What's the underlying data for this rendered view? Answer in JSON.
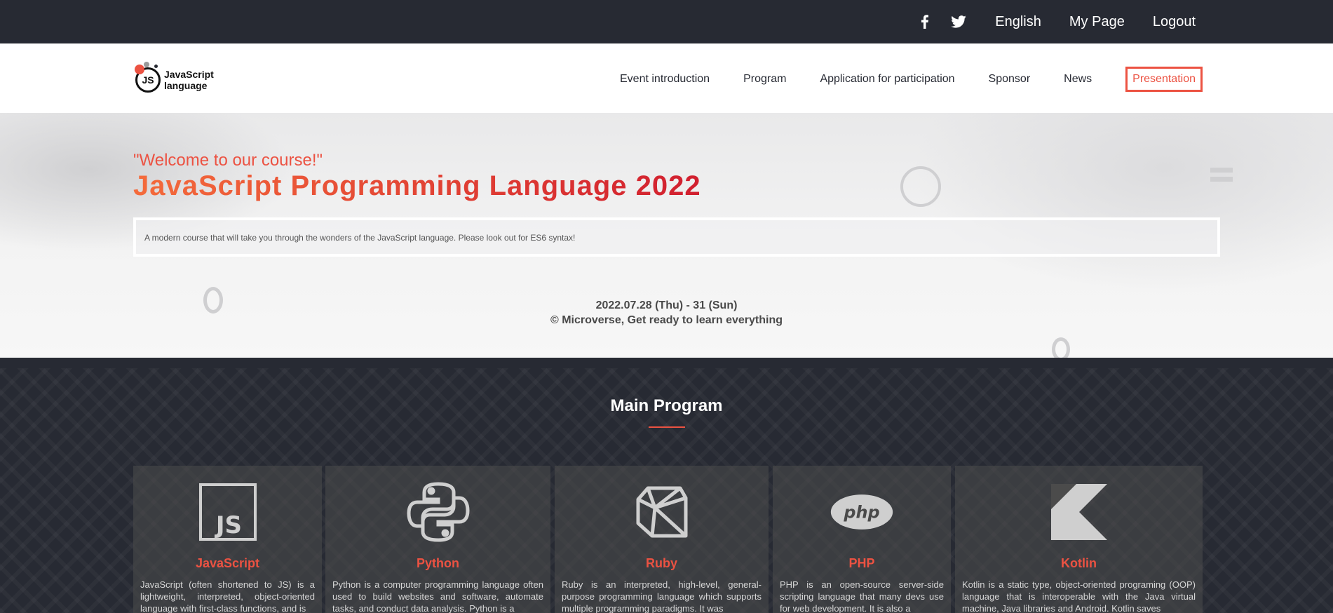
{
  "topbar": {
    "social": [
      "facebook-icon",
      "twitter-icon"
    ],
    "language": "English",
    "my_page": "My Page",
    "logout": "Logout"
  },
  "header": {
    "logo_badge": "JS",
    "logo_line1": "JavaScript",
    "logo_line2": "language",
    "nav": [
      {
        "label": "Event introduction"
      },
      {
        "label": "Program"
      },
      {
        "label": "Application for participation"
      },
      {
        "label": "Sponsor"
      },
      {
        "label": "News"
      },
      {
        "label": "Presentation",
        "active": true
      }
    ]
  },
  "hero": {
    "welcome": "\"Welcome to our course!\"",
    "title": "JavaScript Programming Language 2022",
    "description": "A modern course that will take you through the wonders of the JavaScript language. Please look out for ES6 syntax!",
    "date": "2022.07.28 (Thu) - 31 (Sun)",
    "copyright": "© Microverse, Get ready to learn everything"
  },
  "program": {
    "title": "Main Program",
    "cards": [
      {
        "name": "JavaScript",
        "icon": "js-icon",
        "description": "JavaScript (often shortened to JS) is a lightweight, interpreted, object-oriented language with first-class functions, and is"
      },
      {
        "name": "Python",
        "icon": "python-icon",
        "description": "Python is a computer programming language often used to build websites and software, automate tasks, and conduct data analysis. Python is a"
      },
      {
        "name": "Ruby",
        "icon": "ruby-icon",
        "description": "Ruby is an interpreted, high-level, general-purpose programming language which supports multiple programming paradigms. It was"
      },
      {
        "name": "PHP",
        "icon": "php-icon",
        "description": "PHP is an open-source server-side scripting language that many devs use for web development. It is also a"
      },
      {
        "name": "Kotlin",
        "icon": "kotlin-icon",
        "description": "Kotlin is a static type, object-oriented programing (OOP) language that is interoperable with the Java virtual machine, Java libraries and Android. Kotlin saves"
      }
    ]
  },
  "colors": {
    "accent": "#ec5242",
    "dark": "#272a33"
  }
}
